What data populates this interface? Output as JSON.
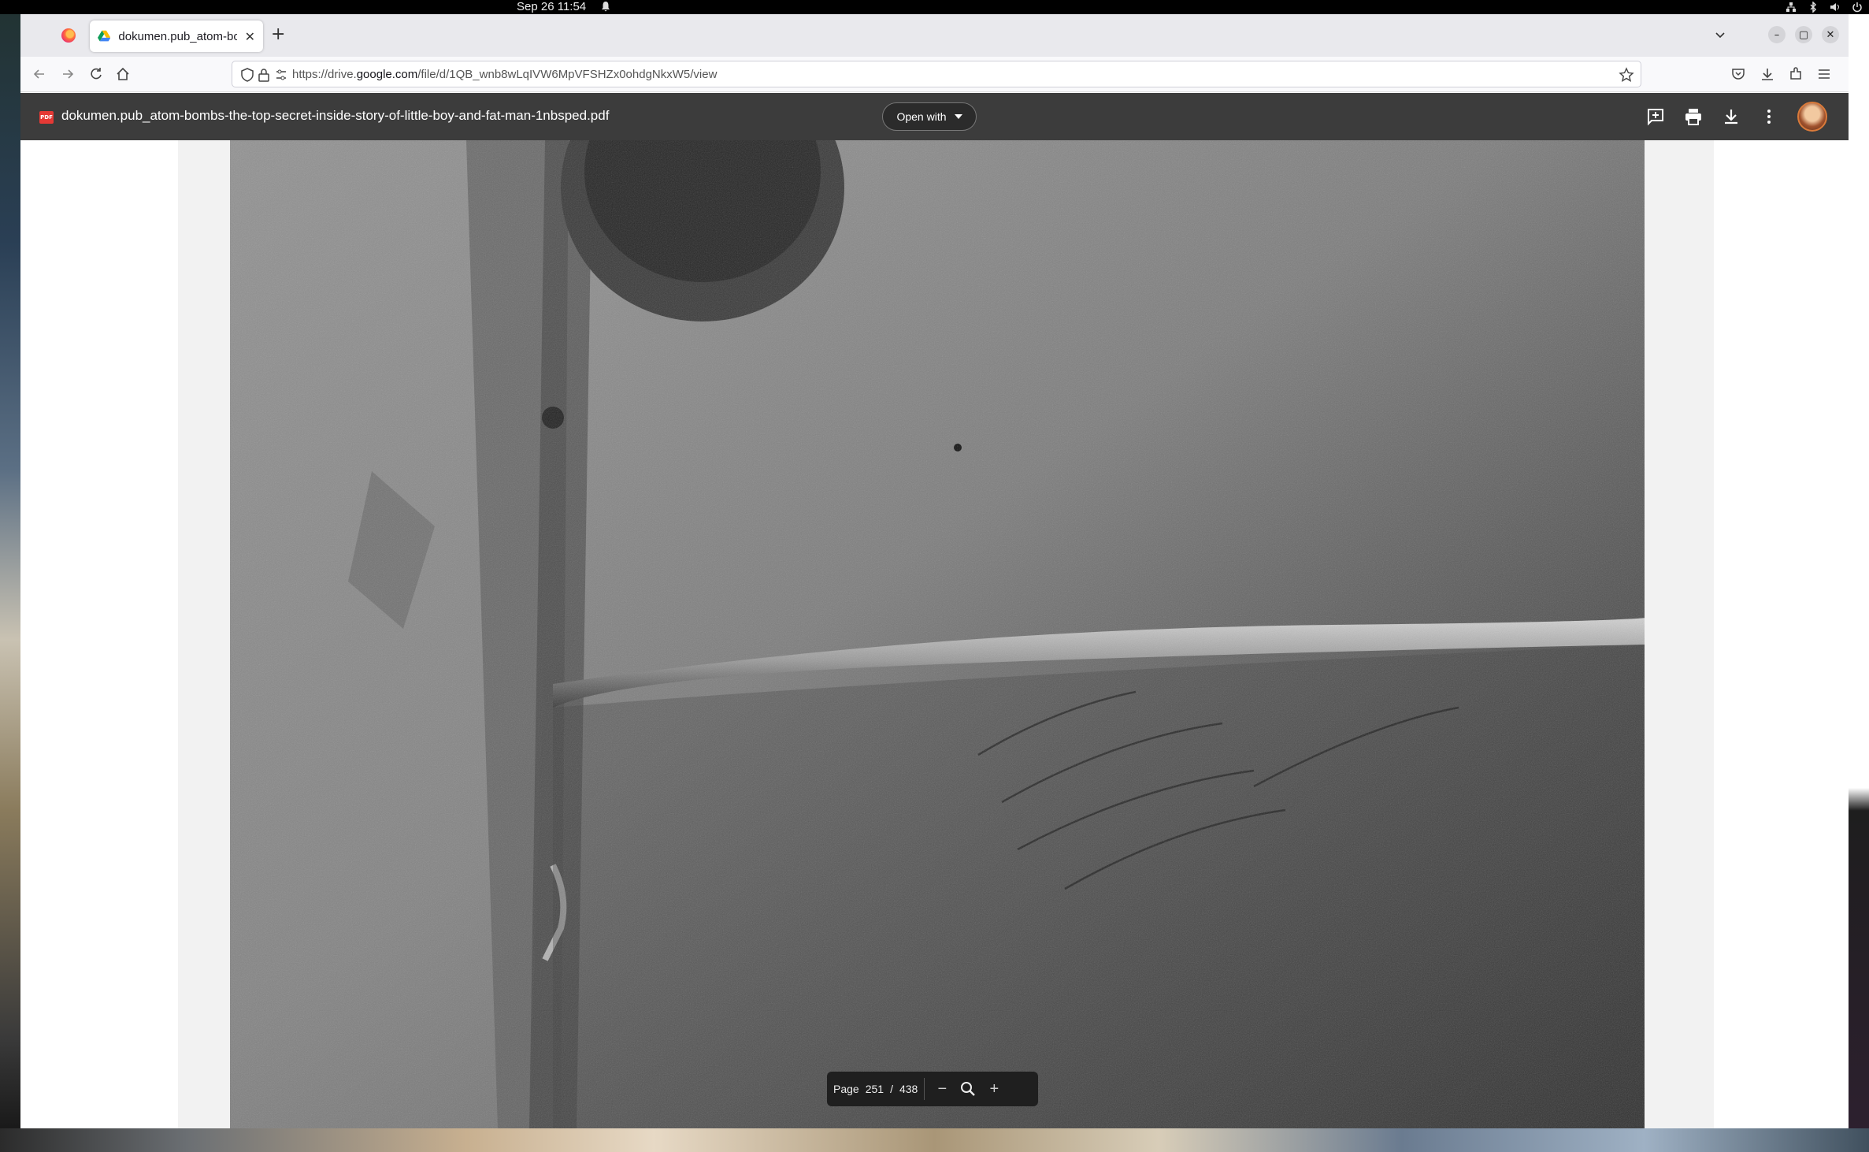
{
  "os": {
    "clock": "Sep 26  11:54"
  },
  "browser": {
    "tab_title": "dokumen.pub_atom-bom",
    "tab_close": "✕",
    "new_tab": "+",
    "url_prefix": "https://drive.",
    "url_domain": "google.com",
    "url_path": "/file/d/1QB_wnb8wLqIVW6MpVFSHZx0ohdgNkxW5/view"
  },
  "viewer": {
    "file_name": "dokumen.pub_atom-bombs-the-top-secret-inside-story-of-little-boy-and-fat-man-1nbsped.pdf",
    "pdf_badge": "PDF",
    "open_with_label": "Open with"
  },
  "page_nav": {
    "page_label": "Page",
    "current_page": "251",
    "separator": "/",
    "total_pages": "438"
  }
}
